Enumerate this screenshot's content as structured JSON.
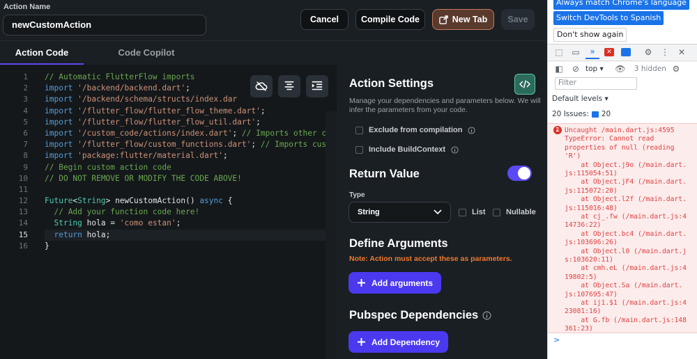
{
  "header": {
    "action_name_label": "Action Name",
    "action_name_value": "newCustomAction",
    "cancel_label": "Cancel",
    "compile_label": "Compile Code",
    "new_tab_label": "New Tab",
    "save_label": "Save"
  },
  "tabs": {
    "action_code": "Action Code",
    "code_copilot": "Code Copilot"
  },
  "editor": {
    "line_numbers": [
      "1",
      "2",
      "3",
      "4",
      "5",
      "6",
      "7",
      "8",
      "9",
      "10",
      "11",
      "12",
      "13",
      "14",
      "15",
      "16"
    ],
    "active_line": 15
  },
  "settings": {
    "title": "Action Settings",
    "description": "Manage your dependencies and parameters below. We will infer the parameters from your code.",
    "exclude_label": "Exclude from compilation",
    "include_context_label": "Include BuildContext",
    "return_value_title": "Return Value",
    "return_value_enabled": true,
    "type_label": "Type",
    "type_value": "String",
    "list_label": "List",
    "nullable_label": "Nullable",
    "define_args_title": "Define Arguments",
    "define_args_note": "Note: Action must accept these as parameters.",
    "add_arguments_label": "Add arguments",
    "pubspec_title": "Pubspec Dependencies",
    "add_dependency_label": "Add Dependency"
  },
  "devtools": {
    "banner_match_label": "Always match Chrome's language",
    "banner_switch_label": "Switch DevTools to Spanish",
    "banner_dismiss_label": "Don't show again",
    "context_label": "top",
    "hidden_count_label": "3 hidden",
    "filter_placeholder": "Filter",
    "levels_label": "Default levels",
    "issues_label": "20 Issues:",
    "issues_count": "20",
    "error_count": "2",
    "error_lines": [
      "Uncaught /main.dart.js:4595",
      "TypeError: Cannot read",
      "properties of null (reading",
      "'R')",
      "    at Object.j9o (/main.dart.",
      "js:115054:51)",
      "    at Object.jF4 (/main.dart.",
      "js:115072:20)",
      "    at Object.l2f (/main.dart.",
      "js:115016:48)",
      "    at cj_.fw (/main.dart.js:4",
      "14736:22)",
      "    at Object.bc4 (/main.dart.",
      "js:103696:26)",
      "    at Object.l0 (/main.dart.j",
      "s:103620:11)",
      "    at cmh.eL (/main.dart.js:4",
      "19802:5)",
      "    at Object.Sa (/main.dart.",
      "js:107695:47)",
      "    at ij1.$1 (/main.dart.js:4",
      "23081:16)",
      "    at G.fb (/main.dart.js:148",
      "361:23)"
    ],
    "prompt_glyph": ">"
  },
  "colors": {
    "accent": "#4b39ef",
    "warning": "#f07a2c",
    "error_text": "#e04141",
    "devtools_blue": "#1a73e8"
  }
}
